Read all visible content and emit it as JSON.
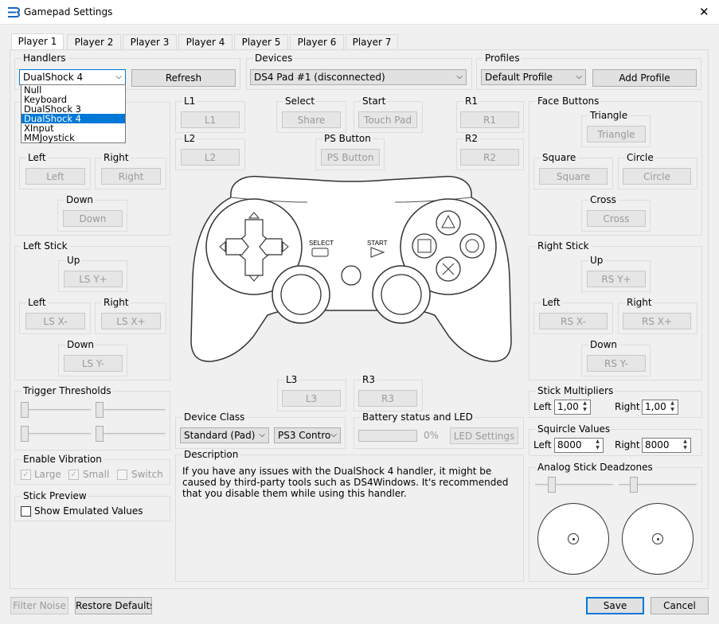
{
  "window": {
    "title": "Gamepad Settings",
    "close_glyph": "✕"
  },
  "tabs": [
    "Player 1",
    "Player 2",
    "Player 3",
    "Player 4",
    "Player 5",
    "Player 6",
    "Player 7"
  ],
  "handlers": {
    "label": "Handlers",
    "selected": "DualShock 4",
    "refresh": "Refresh",
    "options": [
      "Null",
      "Keyboard",
      "DualShock 3",
      "DualShock 4",
      "XInput",
      "MMJoystick"
    ]
  },
  "devices": {
    "label": "Devices",
    "selected": "DS4 Pad #1 (disconnected)"
  },
  "profiles": {
    "label": "Profiles",
    "selected": "Default Profile",
    "add": "Add Profile"
  },
  "dpad": {
    "left_label": "Left",
    "left": "Left",
    "right_label": "Right",
    "right": "Right",
    "down_label": "Down",
    "down": "Down"
  },
  "shoulders": {
    "l1_label": "L1",
    "l1": "L1",
    "l2_label": "L2",
    "l2": "L2",
    "r1_label": "R1",
    "r1": "R1",
    "r2_label": "R2",
    "r2": "R2"
  },
  "center": {
    "select_label": "Select",
    "select": "Share",
    "start_label": "Start",
    "start": "Touch Pad",
    "ps_label": "PS Button",
    "ps": "PS Button"
  },
  "controller_img": {
    "select_text": "SELECT",
    "start_text": "START"
  },
  "face": {
    "label": "Face Buttons",
    "triangle_label": "Triangle",
    "triangle": "Triangle",
    "square_label": "Square",
    "square": "Square",
    "circle_label": "Circle",
    "circle": "Circle",
    "cross_label": "Cross",
    "cross": "Cross"
  },
  "left_stick": {
    "label": "Left Stick",
    "up_label": "Up",
    "up": "LS Y+",
    "left_label": "Left",
    "left": "LS X-",
    "right_label": "Right",
    "right": "LS X+",
    "down_label": "Down",
    "down": "LS Y-"
  },
  "right_stick": {
    "label": "Right Stick",
    "up_label": "Up",
    "up": "RS Y+",
    "left_label": "Left",
    "left": "RS X-",
    "right_label": "Right",
    "right": "RS X+",
    "down_label": "Down",
    "down": "RS Y-"
  },
  "thumbs": {
    "l3_label": "L3",
    "l3": "L3",
    "r3_label": "R3",
    "r3": "R3"
  },
  "triggers": {
    "label": "Trigger Thresholds"
  },
  "vibration": {
    "label": "Enable Vibration",
    "large": "Large",
    "small": "Small",
    "switch": "Switch",
    "check": "✓"
  },
  "preview": {
    "label": "Stick Preview",
    "show": "Show Emulated Values"
  },
  "device_class": {
    "label": "Device Class",
    "type": "Standard (Pad)",
    "subtype": "PS3 Contro"
  },
  "battery": {
    "label": "Battery status and LED",
    "percent": "0%",
    "progress": 0,
    "led": "LED Settings"
  },
  "description": {
    "label": "Description",
    "text": "If you have any issues with the DualShock 4 handler, it might be caused by third-party tools such as DS4Windows. It's recommended that you disable them while using this handler."
  },
  "multipliers": {
    "label": "Stick Multipliers",
    "left_label": "Left",
    "left": "1,00",
    "right_label": "Right",
    "right": "1,00"
  },
  "squircle": {
    "label": "Squircle Values",
    "left_label": "Left",
    "left": "8000",
    "right_label": "Right",
    "right": "8000"
  },
  "deadzones": {
    "label": "Analog Stick Deadzones"
  },
  "footer": {
    "filter": "Filter Noise",
    "restore": "Restore Defaults",
    "save": "Save",
    "cancel": "Cancel"
  }
}
